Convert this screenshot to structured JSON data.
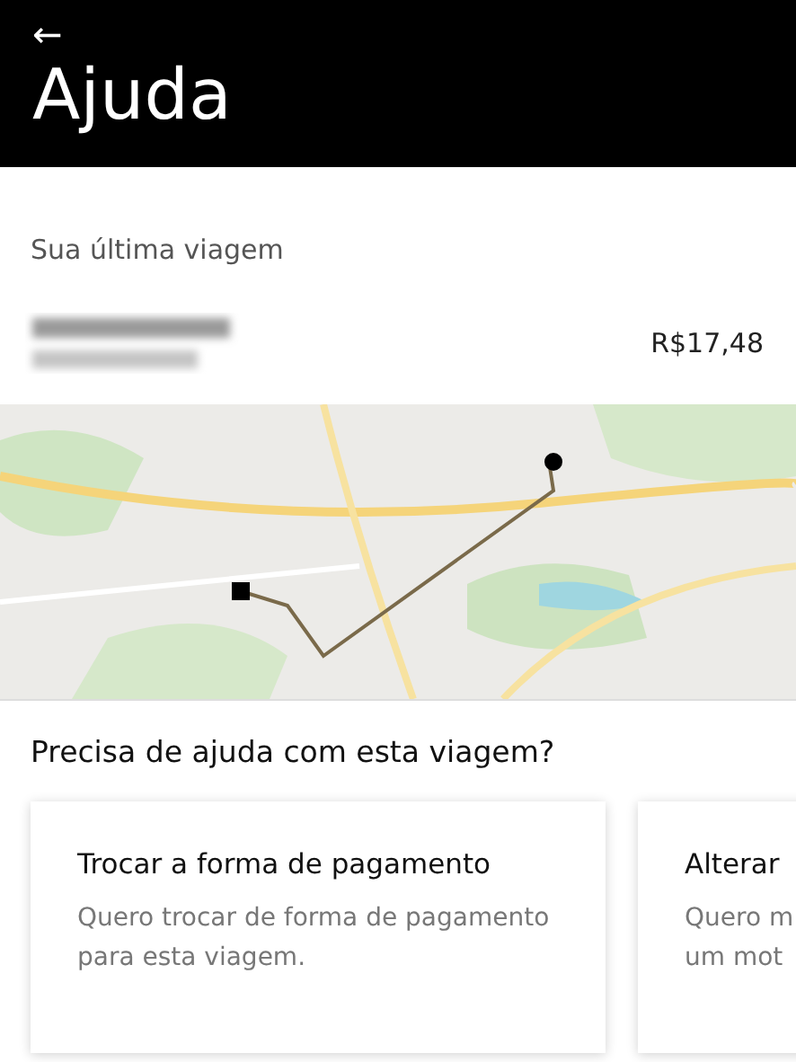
{
  "header": {
    "back": "←",
    "title": "Ajuda"
  },
  "last_trip": {
    "heading": "Sua última viagem",
    "price": "R$17,48"
  },
  "help": {
    "heading": "Precisa de ajuda com esta viagem?",
    "cards": [
      {
        "title": "Trocar a forma de pagamento",
        "lines": [
          "Quero trocar de forma de pagamento",
          "para esta viagem."
        ]
      },
      {
        "title": "Alterar",
        "lines": [
          "Quero m",
          "um mot"
        ]
      }
    ]
  }
}
